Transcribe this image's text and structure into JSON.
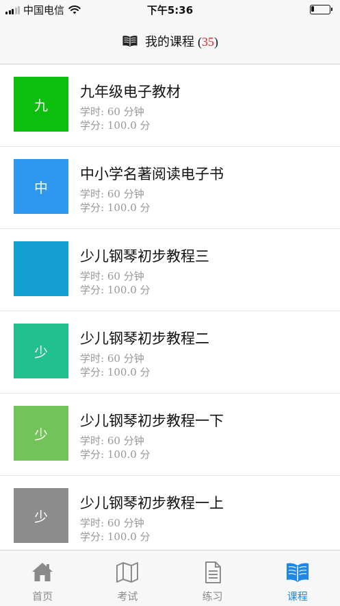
{
  "status_bar": {
    "carrier": "中国电信",
    "time": "下午5:36",
    "battery_level": 0.15
  },
  "header": {
    "title": "我的课程",
    "count_open": "(",
    "count": "35",
    "count_close": ")",
    "icon": "book-open-icon"
  },
  "labels": {
    "hours_label": "学时:",
    "credits_label": "学分:"
  },
  "courses": [
    {
      "thumb_text": "九",
      "thumb_color": "#0dbf0d",
      "title": "九年级电子教材",
      "hours": "60 分钟",
      "credits": "100.0 分"
    },
    {
      "thumb_text": "中",
      "thumb_color": "#2e98f0",
      "title": "中小学名著阅读电子书",
      "hours": "60 分钟",
      "credits": "100.0 分"
    },
    {
      "thumb_text": "",
      "thumb_color": "#139fcf",
      "title": "少儿钢琴初步教程三",
      "hours": "60 分钟",
      "credits": "100.0 分"
    },
    {
      "thumb_text": "少",
      "thumb_color": "#22c08e",
      "title": "少儿钢琴初步教程二",
      "hours": "60 分钟",
      "credits": "100.0 分"
    },
    {
      "thumb_text": "少",
      "thumb_color": "#72c45a",
      "title": "少儿钢琴初步教程一下",
      "hours": "60 分钟",
      "credits": "100.0 分"
    },
    {
      "thumb_text": "少",
      "thumb_color": "#8c8c8c",
      "title": "少儿钢琴初步教程一上",
      "hours": "60 分钟",
      "credits": "100.0 分"
    }
  ],
  "tabs": [
    {
      "label": "首页",
      "icon": "home-icon",
      "active": false
    },
    {
      "label": "考试",
      "icon": "map-icon",
      "active": false
    },
    {
      "label": "练习",
      "icon": "document-icon",
      "active": false
    },
    {
      "label": "课程",
      "icon": "book-open-icon",
      "active": true
    }
  ],
  "colors": {
    "accent": "#1e88e5",
    "count_red": "#e0261b",
    "inactive_tab": "#8a8a8a"
  }
}
